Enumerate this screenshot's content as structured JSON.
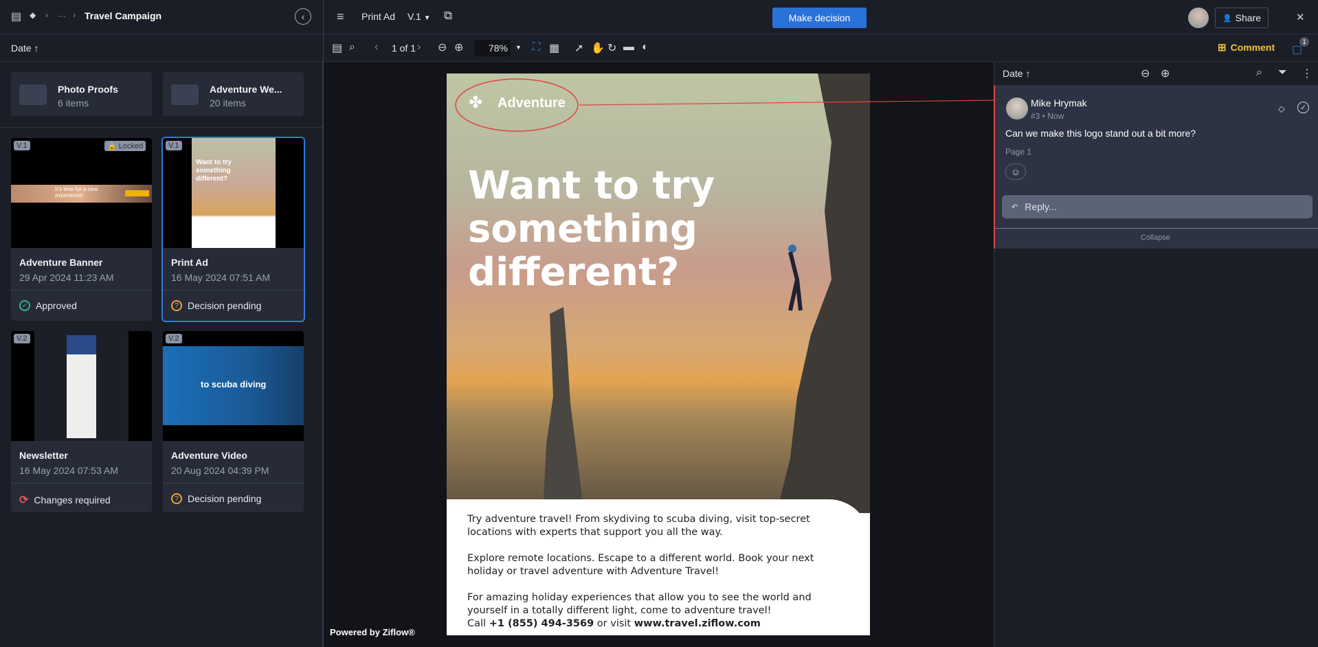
{
  "left_header": {
    "breadcrumb_ellipsis": "···",
    "title": "Travel Campaign",
    "sort_label": "Date"
  },
  "folders": [
    {
      "name": "Photo Proofs",
      "count": "6 items"
    },
    {
      "name": "Adventure We...",
      "count": "20 items"
    }
  ],
  "assets": [
    {
      "name": "Adventure Banner",
      "date": "29 Apr 2024 11:23 AM",
      "version": "V.1",
      "locked": "Locked",
      "status": "Approved",
      "status_color": "#2fb58c",
      "thumb_text": "It's time for a new experience!"
    },
    {
      "name": "Print Ad",
      "date": "16 May 2024 07:51 AM",
      "version": "V.1",
      "status": "Decision pending",
      "status_color": "#f0a526",
      "thumb_text": "Want to try something different?"
    },
    {
      "name": "Newsletter",
      "date": "16 May 2024 07:53 AM",
      "version": "V.2",
      "status": "Changes required",
      "status_color": "#e0535a"
    },
    {
      "name": "Adventure Video",
      "date": "20 Aug 2024 04:39 PM",
      "version": "V.2",
      "status": "Decision pending",
      "status_color": "#f0a526",
      "thumb_text": "to scuba diving"
    }
  ],
  "viewer_header": {
    "title": "Print Ad",
    "version": "V.1",
    "make_decision": "Make decision",
    "share": "Share"
  },
  "toolbar": {
    "page": "1 of 1",
    "zoom": "78",
    "zoom_unit": "%",
    "comment": "Comment",
    "comment_count": "1"
  },
  "ad": {
    "logo": "Adventure",
    "headline": [
      "Want to try",
      "something",
      "different?"
    ],
    "p1": "Try adventure travel! From skydiving to scuba diving, visit top-secret locations with experts that support you all the way.",
    "p2": "Explore remote locations. Escape to a different world. Book your next holiday or travel adventure with Adventure Travel!",
    "p3": "For amazing holiday experiences that allow you to see the world and yourself in a totally different light, come to adventure travel!",
    "call": "Call",
    "phone": "+1 (855) 494-3569",
    "or_visit": "or visit",
    "url": "www.travel.ziflow.com"
  },
  "powered_by": "Powered by Ziflow®",
  "comments_panel": {
    "sort_label": "Date",
    "collapse": "Collapse",
    "reply_placeholder": "Reply..."
  },
  "comment": {
    "author": "Mike Hrymak",
    "meta": "#3 • Now",
    "text": "Can we make this logo stand out a bit more?",
    "page": "Page 1"
  },
  "colors": {
    "accent": "#2a72d8",
    "annotation": "#e0443e",
    "comment_highlight": "#f2c233"
  }
}
